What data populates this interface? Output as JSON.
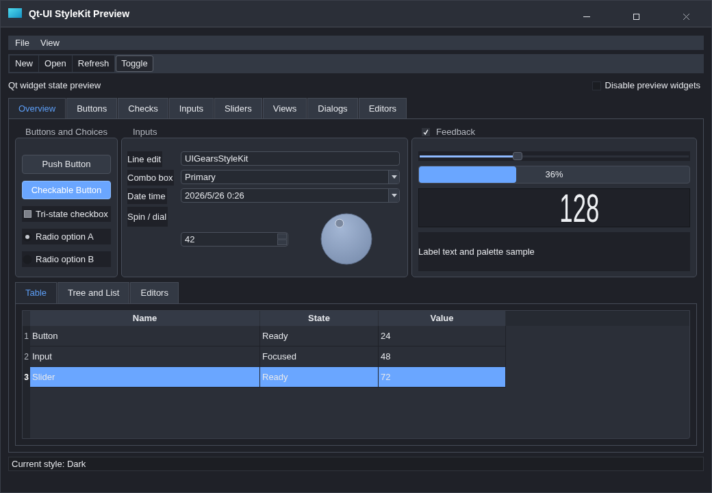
{
  "window": {
    "title": "Qt-UI StyleKit Preview"
  },
  "menu_bar": [
    "File",
    "View"
  ],
  "toolbar": [
    {
      "label": "New",
      "checked": false
    },
    {
      "label": "Open",
      "checked": false
    },
    {
      "label": "Refresh",
      "checked": false
    },
    {
      "label": "Toggle",
      "checked": true
    }
  ],
  "caption": "Qt widget state preview",
  "disable_preview": {
    "label": "Disable preview widgets",
    "checked": false
  },
  "tabs": [
    {
      "label": "Overview",
      "selected": true
    },
    {
      "label": "Buttons",
      "selected": false
    },
    {
      "label": "Checks",
      "selected": false
    },
    {
      "label": "Inputs",
      "selected": false
    },
    {
      "label": "Sliders",
      "selected": false
    },
    {
      "label": "Views",
      "selected": false
    },
    {
      "label": "Dialogs",
      "selected": false
    },
    {
      "label": "Editors",
      "selected": false
    }
  ],
  "buttons_group": {
    "title": "Buttons and Choices",
    "items": [
      {
        "kind": "push",
        "label": "Push Button"
      },
      {
        "kind": "toggle",
        "label": "Checkable Button",
        "checked": true
      },
      {
        "kind": "checkbox",
        "label": "Tri-state checkbox",
        "partial": true
      },
      {
        "kind": "radio",
        "label": "Radio option A",
        "selected": true
      },
      {
        "kind": "radio",
        "label": "Radio option B",
        "selected": false
      }
    ]
  },
  "inputs_group": {
    "title": "Inputs",
    "rows": [
      {
        "kind": "line_edit",
        "label": "Line edit",
        "value": "UIGearsStyleKit"
      },
      {
        "kind": "combo",
        "label": "Combo box",
        "value": "Primary"
      },
      {
        "kind": "combo",
        "label": "Date time",
        "value": "2026/5/26 0:26"
      },
      {
        "kind": "spin_dial",
        "label": "Spin / dial",
        "value": "42",
        "dial": {
          "level": 0.42
        }
      }
    ]
  },
  "feedback_group": {
    "title": "Feedback",
    "checked": true,
    "slider": {
      "level": 0.36
    },
    "progress": {
      "level": 0.36,
      "text": "36%"
    },
    "lcd": "128",
    "label": "Label text and palette sample"
  },
  "lower_tabs": [
    {
      "label": "Table",
      "selected": true
    },
    {
      "label": "Tree and List",
      "selected": false
    },
    {
      "label": "Editors",
      "selected": false
    }
  ],
  "table": {
    "columns": [
      "Name",
      "State",
      "Value"
    ],
    "rows": [
      {
        "number": "1",
        "cells": [
          "Button",
          "Ready",
          "24"
        ],
        "selected": false
      },
      {
        "number": "2",
        "cells": [
          "Input",
          "Focused",
          "48"
        ],
        "selected": false
      },
      {
        "number": "3",
        "cells": [
          "Slider",
          "Ready",
          "72"
        ],
        "selected": true
      }
    ]
  },
  "status_bar": "Current style: Dark"
}
